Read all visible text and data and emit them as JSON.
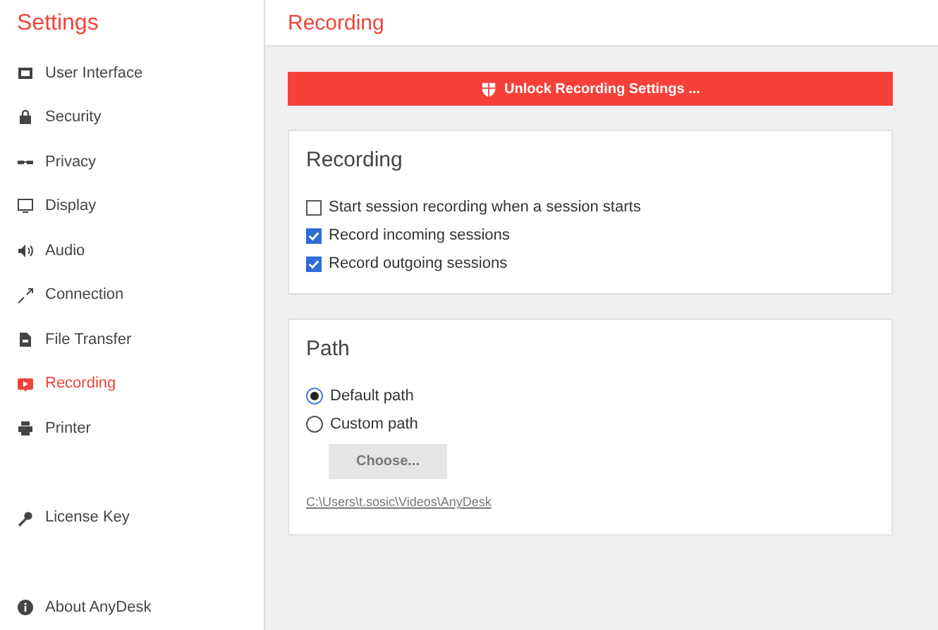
{
  "sidebar": {
    "title": "Settings",
    "items": [
      {
        "label": "User Interface",
        "selected": false
      },
      {
        "label": "Security",
        "selected": false
      },
      {
        "label": "Privacy",
        "selected": false
      },
      {
        "label": "Display",
        "selected": false
      },
      {
        "label": "Audio",
        "selected": false
      },
      {
        "label": "Connection",
        "selected": false
      },
      {
        "label": "File Transfer",
        "selected": false
      },
      {
        "label": "Recording",
        "selected": true
      },
      {
        "label": "Printer",
        "selected": false
      }
    ],
    "bottom_items": [
      {
        "label": "License Key",
        "selected": false
      },
      {
        "label": "About AnyDesk",
        "selected": false
      }
    ]
  },
  "page_title": "Recording",
  "unlock_button": "Unlock Recording Settings ...",
  "recording_section": {
    "title": "Recording",
    "options": [
      {
        "label": "Start session recording when a session starts",
        "checked": false
      },
      {
        "label": "Record incoming sessions",
        "checked": true
      },
      {
        "label": "Record outgoing sessions",
        "checked": true
      }
    ]
  },
  "path_section": {
    "title": "Path",
    "options": [
      {
        "label": "Default path",
        "selected": true
      },
      {
        "label": "Custom path",
        "selected": false
      }
    ],
    "choose_button": {
      "label": "Choose...",
      "disabled": true
    },
    "path_link": "C:\\Users\\t.sosic\\Videos\\AnyDesk"
  }
}
